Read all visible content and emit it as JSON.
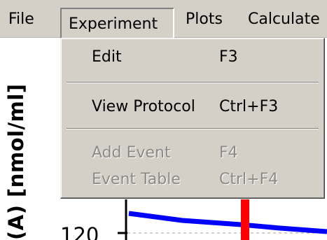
{
  "menubar": {
    "items": [
      {
        "label": "File"
      },
      {
        "label": "Experiment"
      },
      {
        "label": "Plots"
      },
      {
        "label": "Calculate"
      }
    ]
  },
  "experiment_menu": {
    "items": [
      {
        "label": "Edit",
        "shortcut": "F3",
        "enabled": true
      },
      {
        "label": "View Protocol",
        "shortcut": "Ctrl+F3",
        "enabled": true
      },
      {
        "label": "Add Event",
        "shortcut": "F4",
        "enabled": false
      },
      {
        "label": "Event Table",
        "shortcut": "Ctrl+F4",
        "enabled": false
      }
    ]
  },
  "plot": {
    "y_axis_label": "(A) [nmol/ml]",
    "y_tick_label": "120",
    "series_color": "#0000ff",
    "marker_color": "#ff0000"
  }
}
